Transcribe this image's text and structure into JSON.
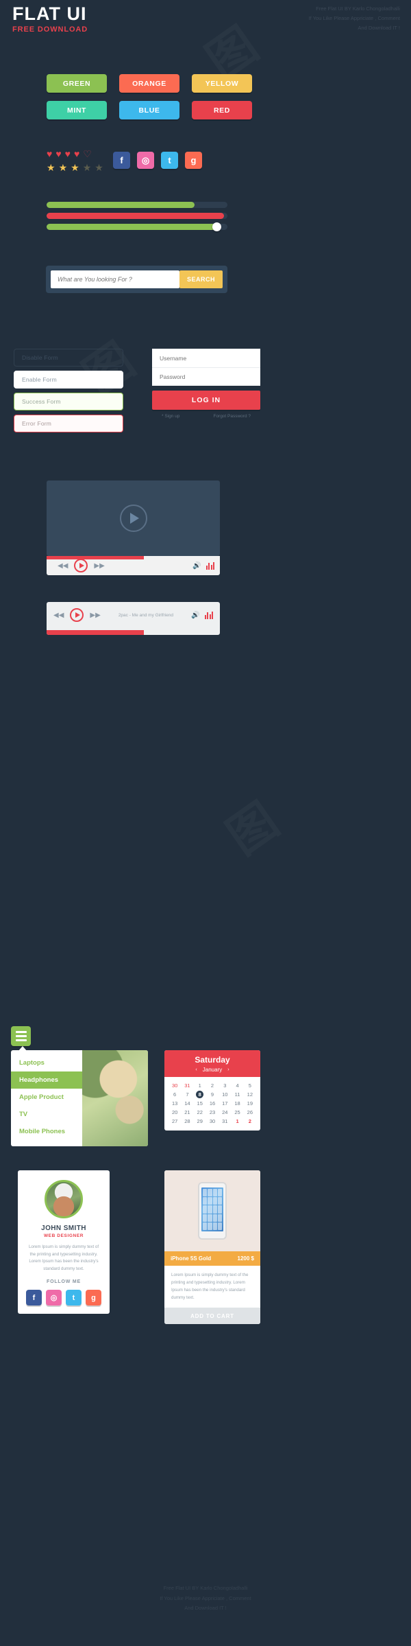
{
  "header": {
    "logo": "FLAT UI",
    "subtitle": "FREE DOWNLOAD",
    "credit_line1": "Free Flat UI  BY Karlo Chongoladhalli",
    "credit_line2": "If You Like Please Appriciate , Comment",
    "credit_line3": "And Download IT !"
  },
  "buttons": [
    {
      "label": "GREEN",
      "color": "#8cc152"
    },
    {
      "label": "ORANGE",
      "color": "#fb6b52"
    },
    {
      "label": "YELLOW",
      "color": "#f3c556"
    },
    {
      "label": "MINT",
      "color": "#3ed0a6"
    },
    {
      "label": "BLUE",
      "color": "#3db8ec"
    },
    {
      "label": "RED",
      "color": "#e8414c"
    }
  ],
  "ratings": {
    "hearts_filled": 4,
    "hearts_total": 5,
    "stars_filled": 3,
    "stars_total": 5,
    "heart_color": "#e8414c",
    "star_color": "#f3c556"
  },
  "social": [
    {
      "name": "facebook",
      "glyph": "f",
      "color": "#3b5a9b"
    },
    {
      "name": "dribbble",
      "glyph": "◎",
      "color": "#ef6ba8"
    },
    {
      "name": "twitter",
      "glyph": "t",
      "color": "#3db8ec"
    },
    {
      "name": "google",
      "glyph": "g",
      "color": "#fb6b52"
    }
  ],
  "progress": [
    {
      "label": "green-bar",
      "value": 82,
      "color": "#8cc152",
      "knob": false
    },
    {
      "label": "red-bar",
      "value": 98,
      "color": "#e8414c",
      "knob": false
    },
    {
      "label": "slider-bar",
      "value": 94,
      "color": "#8cc152",
      "knob": true
    }
  ],
  "search": {
    "placeholder": "What are You looking For ?",
    "value": "",
    "button_label": "SEARCH"
  },
  "forms": [
    {
      "label": "Disable Form",
      "state": "disable"
    },
    {
      "label": "Enable Form",
      "state": "enable"
    },
    {
      "label": "Success Form",
      "state": "success"
    },
    {
      "label": "Error Form",
      "state": "error"
    }
  ],
  "login": {
    "username_placeholder": "Username",
    "password_placeholder": "Password",
    "username_value": "",
    "password_value": "",
    "button_label": "LOG IN",
    "signup_link": "* Sign up",
    "forgot_link": "Forgot Password ?"
  },
  "player": {
    "track_title": "2pac - Me and my Girlfriend",
    "progress_main": 56,
    "progress_second": 56
  },
  "menu": {
    "items": [
      {
        "label": "Laptops",
        "active": false
      },
      {
        "label": "Headphones",
        "active": true
      },
      {
        "label": "Apple Product",
        "active": false
      },
      {
        "label": "TV",
        "active": false
      },
      {
        "label": "Mobile Phones",
        "active": false
      }
    ]
  },
  "calendar": {
    "day_name": "Saturday",
    "month": "January",
    "prev": "‹",
    "next": "›",
    "selected_day": 8,
    "weeks": [
      [
        "30",
        "31",
        "1",
        "2",
        "3",
        "4",
        "5"
      ],
      [
        "6",
        "7",
        "8",
        "9",
        "10",
        "11",
        "12"
      ],
      [
        "13",
        "14",
        "15",
        "16",
        "17",
        "18",
        "19"
      ],
      [
        "20",
        "21",
        "22",
        "23",
        "24",
        "25",
        "26"
      ],
      [
        "27",
        "28",
        "29",
        "30",
        "31",
        "1",
        "2"
      ]
    ],
    "muted_cells": [
      "0-0",
      "0-1"
    ],
    "red_cells": [
      "4-5",
      "4-6"
    ]
  },
  "profile": {
    "name": "JOHN SMITH",
    "role": "WEB DESIGNER",
    "bio": "Lorem Ipsum is simply dummy text of the printing and typesetting industry. Lorem Ipsum has been the industry's standard dummy text.",
    "follow_label": "FOLLOW ME",
    "social": [
      {
        "name": "facebook",
        "glyph": "f",
        "color": "#3b5a9b"
      },
      {
        "name": "dribbble",
        "glyph": "◎",
        "color": "#ef6ba8"
      },
      {
        "name": "twitter",
        "glyph": "t",
        "color": "#3db8ec"
      },
      {
        "name": "google",
        "glyph": "g",
        "color": "#fb6b52"
      }
    ]
  },
  "product": {
    "title": "iPhone 5S Gold",
    "price": "1200 $",
    "description": "Lorem Ipsum is simply dummy text of the printing and typesetting industry. Lorem Ipsum has been the industry's standard dummy text.",
    "cart_label": "ADD TO CART"
  },
  "footer": {
    "credit_line1": "Free Flat UI  BY Karlo Chongoladhalli",
    "credit_line2": "If You Like Please Appriciate , Comment",
    "credit_line3": "And Download IT !"
  }
}
